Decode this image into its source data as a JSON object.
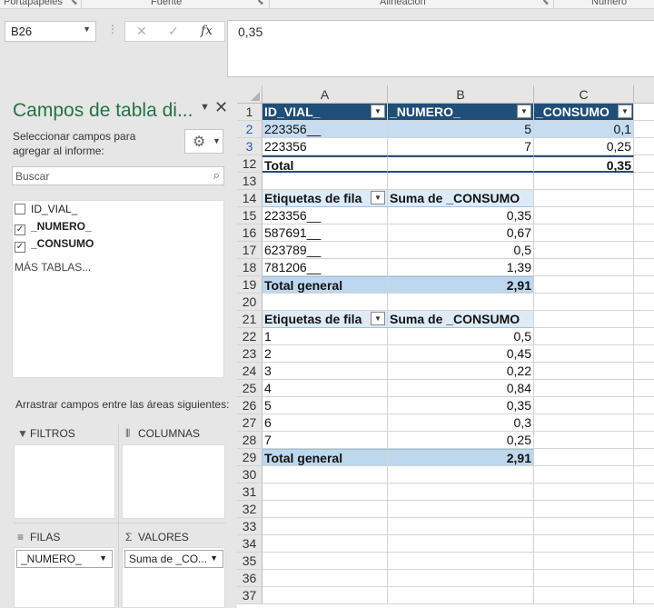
{
  "ribbon": {
    "groups": [
      "Portapapeles",
      "Fuente",
      "Alineación",
      "Número"
    ]
  },
  "formula_bar": {
    "name_box": "B26",
    "formula": "0,35",
    "icons": [
      "cancel-icon",
      "enter-icon",
      "function-icon"
    ]
  },
  "pane": {
    "title": "Campos de tabla di...",
    "instruction": "Seleccionar campos para agregar al informe:",
    "search_placeholder": "Buscar",
    "fields": [
      {
        "label": "ID_VIAL_",
        "checked": false
      },
      {
        "label": "_NUMERO_",
        "checked": true
      },
      {
        "label": "_CONSUMO",
        "checked": true
      }
    ],
    "more_tables": "MÁS TABLAS...",
    "drag_instruction": "Arrastrar campos entre las áreas siguientes:",
    "areas": {
      "filters": {
        "label": "FILTROS"
      },
      "columns": {
        "label": "COLUMNAS"
      },
      "rows": {
        "label": "FILAS",
        "item": "_NUMERO_"
      },
      "values": {
        "label": "VALORES",
        "item": "Suma de _CO..."
      }
    }
  },
  "grid": {
    "columns": [
      "A",
      "B",
      "C"
    ],
    "rows": [
      {
        "n": "1",
        "cells": [
          "ID_VIAL_",
          "_NUMERO_",
          "_CONSUMO"
        ],
        "style": "table-header"
      },
      {
        "n": "2",
        "cells": [
          "223356__",
          "5",
          "0,1"
        ],
        "style": "band"
      },
      {
        "n": "3",
        "cells": [
          "223356",
          "7",
          "0,25"
        ],
        "style": "plain"
      },
      {
        "n": "12",
        "cells": [
          "Total",
          "",
          "0,35"
        ],
        "style": "total"
      },
      {
        "n": "13",
        "cells": [
          "",
          "",
          ""
        ],
        "style": "empty"
      },
      {
        "n": "14",
        "cells": [
          "Etiquetas de fila",
          "Suma de _CONSUMO",
          ""
        ],
        "style": "pivot-header"
      },
      {
        "n": "15",
        "cells": [
          "223356__",
          "0,35",
          ""
        ],
        "style": "pivot"
      },
      {
        "n": "16",
        "cells": [
          "587691__",
          "0,67",
          ""
        ],
        "style": "pivot"
      },
      {
        "n": "17",
        "cells": [
          "623789__",
          "0,5",
          ""
        ],
        "style": "pivot"
      },
      {
        "n": "18",
        "cells": [
          "781206__",
          "1,39",
          ""
        ],
        "style": "pivot"
      },
      {
        "n": "19",
        "cells": [
          "Total general",
          "2,91",
          ""
        ],
        "style": "pivot-total"
      },
      {
        "n": "20",
        "cells": [
          "",
          "",
          ""
        ],
        "style": "empty"
      },
      {
        "n": "21",
        "cells": [
          "Etiquetas de fila",
          "Suma de _CONSUMO",
          ""
        ],
        "style": "pivot-header"
      },
      {
        "n": "22",
        "cells": [
          "1",
          "0,5",
          ""
        ],
        "style": "pivot"
      },
      {
        "n": "23",
        "cells": [
          "2",
          "0,45",
          ""
        ],
        "style": "pivot"
      },
      {
        "n": "24",
        "cells": [
          "3",
          "0,22",
          ""
        ],
        "style": "pivot"
      },
      {
        "n": "25",
        "cells": [
          "4",
          "0,84",
          ""
        ],
        "style": "pivot"
      },
      {
        "n": "26",
        "cells": [
          "5",
          "0,35",
          ""
        ],
        "style": "pivot"
      },
      {
        "n": "27",
        "cells": [
          "6",
          "0,3",
          ""
        ],
        "style": "pivot"
      },
      {
        "n": "28",
        "cells": [
          "7",
          "0,25",
          ""
        ],
        "style": "pivot"
      },
      {
        "n": "29",
        "cells": [
          "Total general",
          "2,91",
          ""
        ],
        "style": "pivot-total"
      },
      {
        "n": "30",
        "cells": [
          "",
          "",
          ""
        ],
        "style": "empty"
      },
      {
        "n": "31",
        "cells": [
          "",
          "",
          ""
        ],
        "style": "empty"
      },
      {
        "n": "32",
        "cells": [
          "",
          "",
          ""
        ],
        "style": "empty"
      },
      {
        "n": "33",
        "cells": [
          "",
          "",
          ""
        ],
        "style": "empty"
      },
      {
        "n": "34",
        "cells": [
          "",
          "",
          ""
        ],
        "style": "empty"
      },
      {
        "n": "35",
        "cells": [
          "",
          "",
          ""
        ],
        "style": "empty"
      },
      {
        "n": "36",
        "cells": [
          "",
          "",
          ""
        ],
        "style": "empty"
      },
      {
        "n": "37",
        "cells": [
          "",
          "",
          ""
        ],
        "style": "empty"
      }
    ]
  },
  "colors": {
    "pane_title": "#217346",
    "table_header": "#1f4e79",
    "pivot_header": "#ddebf7",
    "pivot_total": "#bdd7ee",
    "band": "#c6dcf1"
  }
}
